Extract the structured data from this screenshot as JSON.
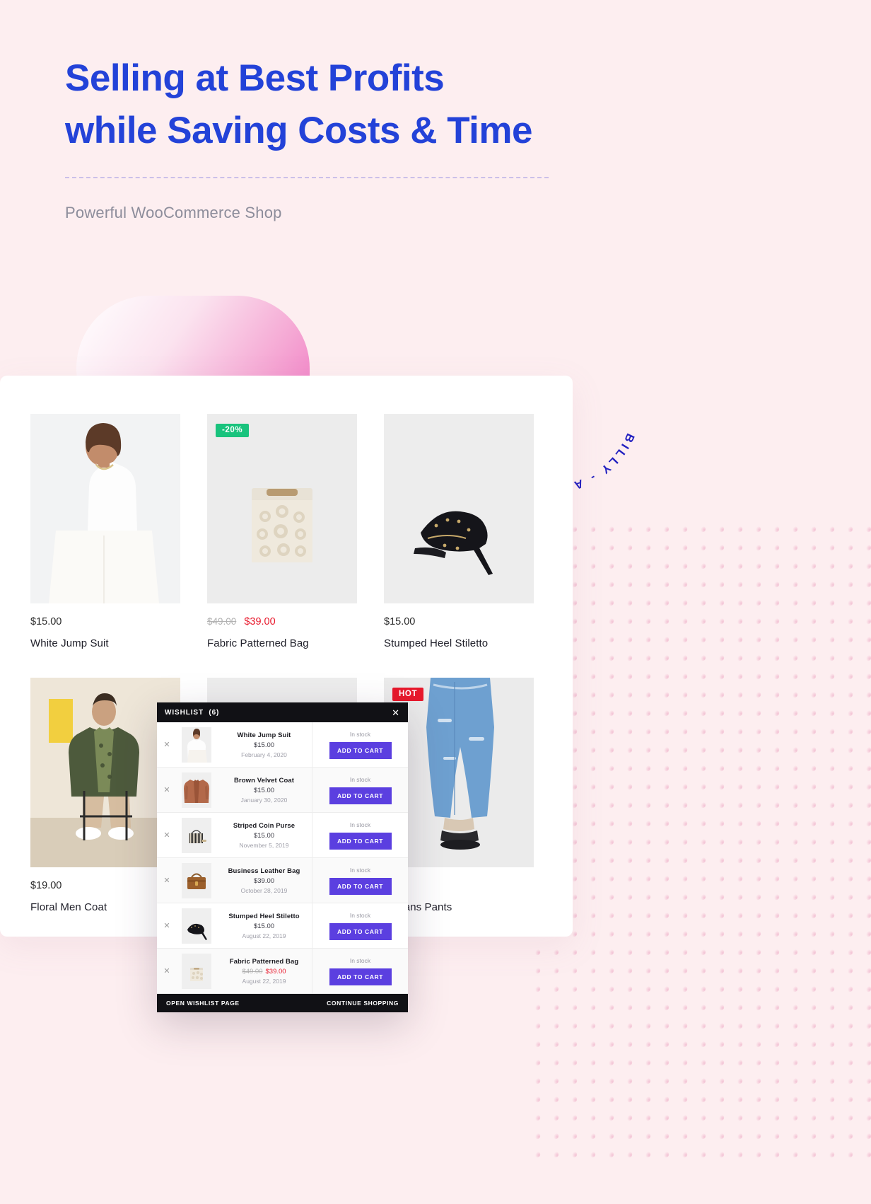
{
  "hero": {
    "line1": "Selling at Best Profits",
    "line2_a": "while Saving",
    "line2_b": "Costs & Time",
    "subtitle": "Powerful WooCommerce Shop",
    "heading_color": "#2342d8",
    "subtitle_color": "#8d8d9b"
  },
  "stamp": {
    "text": "BILLY - AN ABSOLUTELY AWESOME WORDPRESS THEME",
    "color": "#2321c0"
  },
  "shop": {
    "products": [
      {
        "badge": "",
        "badge_type": "",
        "price": "$15.00",
        "old_price": "",
        "new_price": "",
        "title": "White Jump Suit",
        "art": "woman-white-top"
      },
      {
        "badge": "-20%",
        "badge_type": "sale",
        "price": "",
        "old_price": "$49.00",
        "new_price": "$39.00",
        "title": "Fabric Patterned Bag",
        "art": "lace-tote-bag"
      },
      {
        "badge": "",
        "badge_type": "",
        "price": "$15.00",
        "old_price": "",
        "new_price": "",
        "title": "Stumped Heel Stiletto",
        "art": "black-stiletto"
      },
      {
        "badge": "",
        "badge_type": "",
        "price": "$19.00",
        "old_price": "",
        "new_price": "",
        "title": "Floral Men Coat",
        "art": "man-green-coat"
      },
      {
        "badge": "",
        "badge_type": "",
        "price": "",
        "old_price": "",
        "new_price": "",
        "title": "",
        "art": "plain-grey"
      },
      {
        "badge": "HOT",
        "badge_type": "hot",
        "price": "",
        "old_price": "",
        "new_price": "",
        "title": "d Jeans Pants",
        "art": "blue-jeans"
      }
    ],
    "badge_colors": {
      "sale": "#19c37d",
      "hot": "#e8192c"
    }
  },
  "wishlist": {
    "title": "WISHLIST",
    "count": "(6)",
    "close_icon": "close-icon",
    "accent": "#5b3fe0",
    "open_page_label": "OPEN WISHLIST PAGE",
    "continue_label": "CONTINUE SHOPPING",
    "items": [
      {
        "name": "White Jump Suit",
        "price": "$15.00",
        "old_price": "",
        "new_price": "",
        "date": "February 4, 2020",
        "stock": "In stock",
        "cart_label": "ADD TO CART",
        "art": "woman-white-top"
      },
      {
        "name": "Brown Velvet Coat",
        "price": "$15.00",
        "old_price": "",
        "new_price": "",
        "date": "January 30, 2020",
        "stock": "In stock",
        "cart_label": "ADD TO CART",
        "art": "brown-coat"
      },
      {
        "name": "Striped Coin Purse",
        "price": "$15.00",
        "old_price": "",
        "new_price": "",
        "date": "November 5, 2019",
        "stock": "In stock",
        "cart_label": "ADD TO CART",
        "art": "striped-purse"
      },
      {
        "name": "Business Leather Bag",
        "price": "$39.00",
        "old_price": "",
        "new_price": "",
        "date": "October 28, 2019",
        "stock": "In stock",
        "cart_label": "ADD TO CART",
        "art": "leather-bag"
      },
      {
        "name": "Stumped Heel Stiletto",
        "price": "$15.00",
        "old_price": "",
        "new_price": "",
        "date": "August 22, 2019",
        "stock": "In stock",
        "cart_label": "ADD TO CART",
        "art": "black-stiletto"
      },
      {
        "name": "Fabric Patterned Bag",
        "price": "",
        "old_price": "$49.00",
        "new_price": "$39.00",
        "date": "August 22, 2019",
        "stock": "In stock",
        "cart_label": "ADD TO CART",
        "art": "lace-tote-bag"
      }
    ]
  }
}
